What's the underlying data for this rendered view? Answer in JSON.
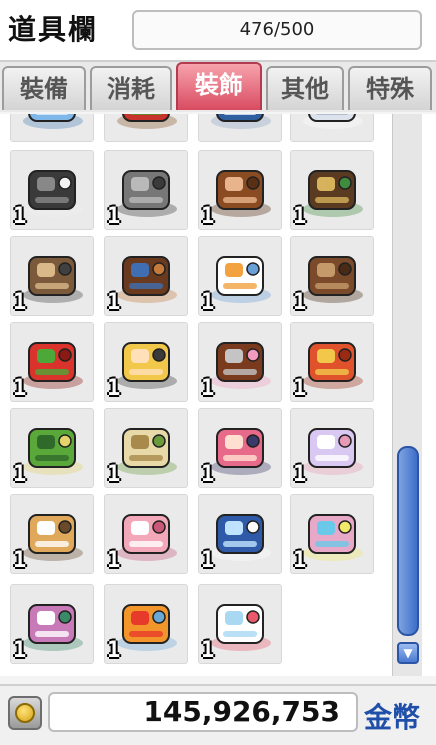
{
  "title": "道具欄",
  "capacity": "476/500",
  "tabs": [
    {
      "label": "裝備",
      "active": false
    },
    {
      "label": "消耗",
      "active": false
    },
    {
      "label": "裝飾",
      "active": true
    },
    {
      "label": "其他",
      "active": false
    },
    {
      "label": "特殊",
      "active": false
    }
  ],
  "items": [
    {
      "icon": "ice-block-icon",
      "qty": ""
    },
    {
      "icon": "fruit-basket-icon",
      "qty": ""
    },
    {
      "icon": "snow-sled-icon",
      "qty": ""
    },
    {
      "icon": "cloud-icon",
      "qty": ""
    },
    {
      "icon": "whale-submarine-icon",
      "qty": "1"
    },
    {
      "icon": "shopping-cart-icon",
      "qty": "1"
    },
    {
      "icon": "wooden-door-explorer-icon",
      "qty": "1"
    },
    {
      "icon": "horse-carousel-icon",
      "qty": "1"
    },
    {
      "icon": "food-cart-icon",
      "qty": "1"
    },
    {
      "icon": "fox-hut-icon",
      "qty": "1"
    },
    {
      "icon": "snowman-icon",
      "qty": "1"
    },
    {
      "icon": "donkey-fence-icon",
      "qty": "1"
    },
    {
      "icon": "radish-icon",
      "qty": "1"
    },
    {
      "icon": "blonde-boy-icon",
      "qty": "1"
    },
    {
      "icon": "chocolate-fountain-icon",
      "qty": "1"
    },
    {
      "icon": "fortune-bag-icon",
      "qty": "1"
    },
    {
      "icon": "frog-pouch-icon",
      "qty": "1"
    },
    {
      "icon": "dumpling-icon",
      "qty": "1"
    },
    {
      "icon": "pink-hair-girl-icon",
      "qty": "1"
    },
    {
      "icon": "crystal-castle-cake-icon",
      "qty": "1"
    },
    {
      "icon": "tiered-cake-icon",
      "qty": "1"
    },
    {
      "icon": "pink-layer-cake-icon",
      "qty": "1"
    },
    {
      "icon": "snow-globe-icon",
      "qty": "1"
    },
    {
      "icon": "rainbow-jar-icon",
      "qty": "1"
    },
    {
      "icon": "picture-book-icon",
      "qty": "1"
    },
    {
      "icon": "autumn-tree-pedestal-icon",
      "qty": "1"
    },
    {
      "icon": "fruit-bowl-icon",
      "qty": "1"
    }
  ],
  "money": "145,926,753",
  "money_label": "金幣",
  "colors": {
    "active_tab": "#d84b60",
    "tab_rule": "#b8343f",
    "scroll_thumb": "#3e6ecb",
    "money_label": "#1f4fa8"
  }
}
